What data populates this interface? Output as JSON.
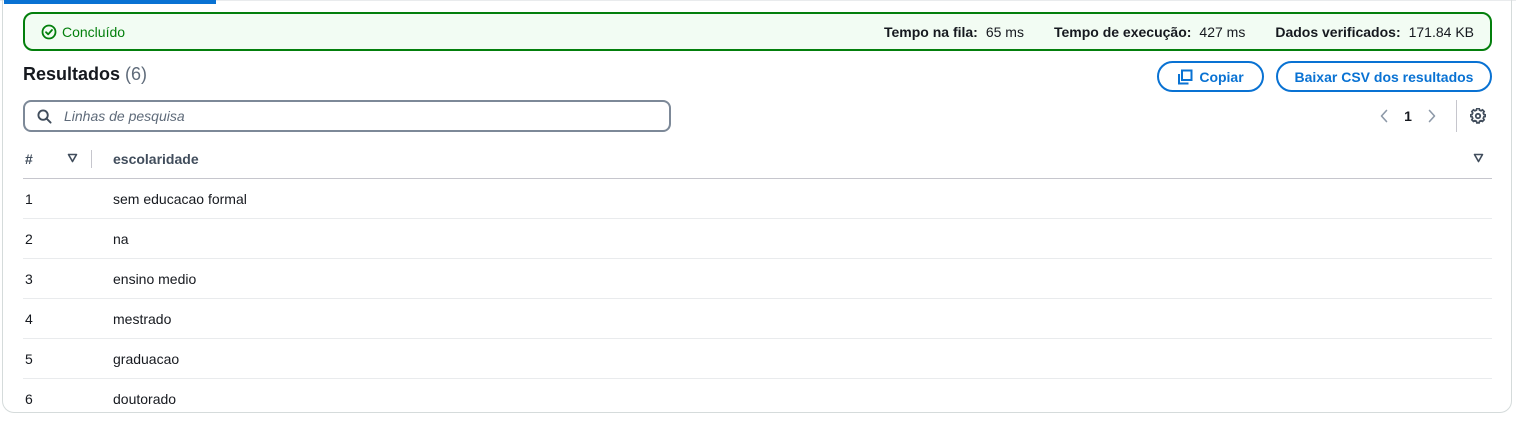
{
  "status": {
    "label": "Concluído",
    "icon": "check-circle-icon",
    "stats": [
      {
        "label": "Tempo na fila:",
        "value": "65 ms"
      },
      {
        "label": "Tempo de execução:",
        "value": "427 ms"
      },
      {
        "label": "Dados verificados:",
        "value": "171.84 KB"
      }
    ]
  },
  "results": {
    "title": "Resultados",
    "count": "(6)",
    "copy_label": "Copiar",
    "csv_label": "Baixar CSV dos resultados"
  },
  "search": {
    "placeholder": "Linhas de pesquisa",
    "value": ""
  },
  "pagination": {
    "current_page": "1"
  },
  "table": {
    "headers": {
      "index": "#",
      "column": "escolaridade"
    },
    "rows": [
      {
        "index": "1",
        "escolaridade": "sem educacao formal"
      },
      {
        "index": "2",
        "escolaridade": "na"
      },
      {
        "index": "3",
        "escolaridade": "ensino medio"
      },
      {
        "index": "4",
        "escolaridade": "mestrado"
      },
      {
        "index": "5",
        "escolaridade": "graduacao"
      },
      {
        "index": "6",
        "escolaridade": "doutorado"
      }
    ]
  },
  "colors": {
    "accent": "#0972d3",
    "success": "#037f0c",
    "success_bg": "#f2fcf3"
  }
}
